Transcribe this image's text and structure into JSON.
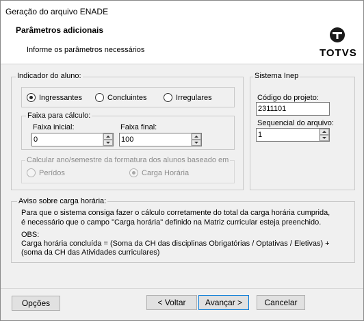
{
  "window": {
    "title": "Geração do arquivo ENADE"
  },
  "header": {
    "title": "Parâmetros adicionais",
    "subtitle": "Informe os parâmetros necessários",
    "logo_text": "TOTVS"
  },
  "indicador": {
    "legend": "Indicador do aluno:",
    "options": [
      {
        "label": "Ingressantes",
        "selected": true
      },
      {
        "label": "Concluintes",
        "selected": false
      },
      {
        "label": "Irregulares",
        "selected": false
      }
    ]
  },
  "faixa": {
    "legend": "Faixa para cálculo:",
    "inicial_label": "Faixa inicial:",
    "inicial_value": "0",
    "final_label": "Faixa final:",
    "final_value": "100"
  },
  "calcular": {
    "legend": "Calcular ano/semestre da formatura dos alunos baseado em",
    "options": [
      {
        "label": "Perídos",
        "selected": false
      },
      {
        "label": "Carga Horária",
        "selected": true
      }
    ]
  },
  "inep": {
    "legend": "Sistema Inep",
    "codigo_label": "Código do projeto:",
    "codigo_value": "2311101",
    "sequencial_label": "Sequencial do arquivo:",
    "sequencial_value": "1"
  },
  "aviso": {
    "legend": "Aviso sobre carga horária:",
    "lines": [
      "Para que o sistema consiga fazer o cálculo corretamente do total da carga horária cumprida,",
      "é necessário que o campo \"Carga horária\" definido na Matriz curricular esteja preenchido.",
      "OBS:",
      "Carga horária concluída = (Soma da CH das disciplinas Obrigatórias / Optativas / Eletivas) +",
      "(soma da CH das Atividades curriculares)"
    ]
  },
  "buttons": {
    "opcoes": "Opções",
    "voltar": "< Voltar",
    "avancar": "Avançar >",
    "cancelar": "Cancelar"
  }
}
